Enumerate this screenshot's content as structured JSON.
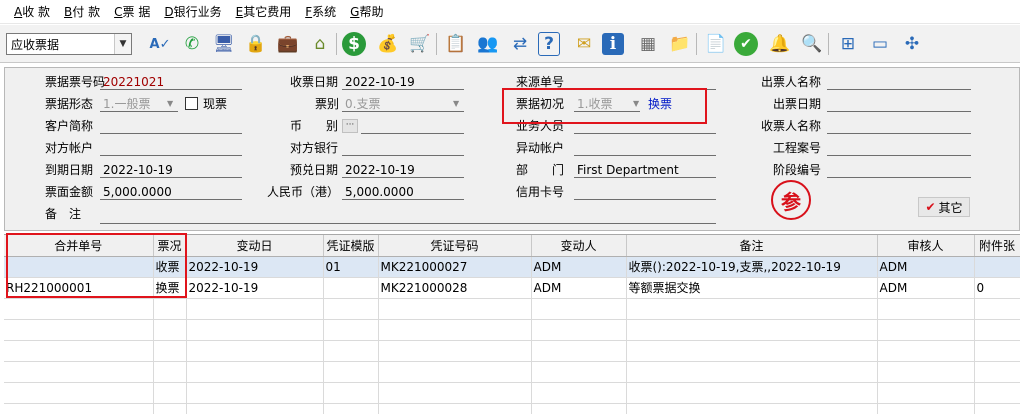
{
  "menu": [
    {
      "key": "A",
      "label": "收 款"
    },
    {
      "key": "B",
      "label": "付 款"
    },
    {
      "key": "C",
      "label": "票 据"
    },
    {
      "key": "D",
      "label": "银行业务"
    },
    {
      "key": "E",
      "label": "其它费用"
    },
    {
      "key": "F",
      "label": "系统"
    },
    {
      "key": "G",
      "label": "帮助"
    }
  ],
  "toolbar": {
    "combo_value": "应收票据",
    "icons": [
      "spellcheck-icon",
      "phone-icon",
      "computer-icon",
      "lock-icon",
      "briefcase-icon",
      "house-icon",
      "dollar-icon",
      "money-bag-icon",
      "cart-icon",
      "clipboard-icon",
      "people-icon",
      "sync-icon",
      "help-icon",
      "mail-icon",
      "info-icon",
      "calculator-icon",
      "folder-icon",
      "document-icon",
      "check-circle-icon",
      "bell-icon",
      "magnifier-icon",
      "org-chart-icon",
      "monitor-icon",
      "network-icon"
    ]
  },
  "form": {
    "bill_no_label": "票号码",
    "bill_no_prefix": "票据",
    "bill_no": "20221021",
    "bill_form_label": "票据形态",
    "bill_form_value": "1.一般票",
    "cash_label": "现票",
    "customer_short_label": "客户简称",
    "customer_short_value": "",
    "counter_account_label": "对方帐户",
    "counter_account_value": "",
    "due_date_label": "到期日期",
    "due_date_value": "2022-10-19",
    "face_amount_label": "票面金额",
    "face_amount_value": "5,000.0000",
    "remark_label": "备　注",
    "remark_value": "",
    "receive_date_label": "收票日期",
    "receive_date_value": "2022-10-19",
    "bill_type_label": "票别",
    "bill_type_value": "0.支票",
    "currency_label": "币　　别",
    "currency_value": "",
    "counter_bank_label": "对方银行",
    "counter_bank_value": "",
    "expected_date_label": "预兑日期",
    "expected_date_value": "2022-10-19",
    "rmb_label": "人民币（港）",
    "rmb_value": "5,000.0000",
    "source_no_label": "来源单号",
    "source_no_value": "",
    "bill_status_label": "票据初况",
    "bill_status_value": "1.收票",
    "exchange_link": "换票",
    "salesperson_label": "业务人员",
    "salesperson_value": "",
    "change_account_label": "异动帐户",
    "change_account_value": "",
    "dept_label": "部　　门",
    "dept_value": "First Department",
    "credit_card_label": "信用卡号",
    "credit_card_value": "",
    "drawer_name_label": "出票人名称",
    "drawer_name_value": "",
    "issue_date_label": "出票日期",
    "issue_date_value": "",
    "payee_name_label": "收票人名称",
    "payee_name_value": "",
    "project_no_label": "工程案号",
    "project_no_value": "",
    "stage_no_label": "阶段编号",
    "stage_no_value": "",
    "stamp_char": "参",
    "other_button": "其它"
  },
  "grid": {
    "columns": [
      "合并单号",
      "票况",
      "变动日",
      "凭证模版",
      "凭证号码",
      "变动人",
      "备注",
      "审核人",
      "附件张"
    ],
    "rows": [
      [
        "",
        "收票",
        "2022-10-19",
        "01",
        "MK221000027",
        "ADM",
        "收票():2022-10-19,支票,,2022-10-19",
        "ADM",
        ""
      ],
      [
        "RH221000001",
        "换票",
        "2022-10-19",
        "",
        "MK221000028",
        "ADM",
        "等额票据交换",
        "ADM",
        "0"
      ]
    ],
    "empty_rows": 6
  }
}
